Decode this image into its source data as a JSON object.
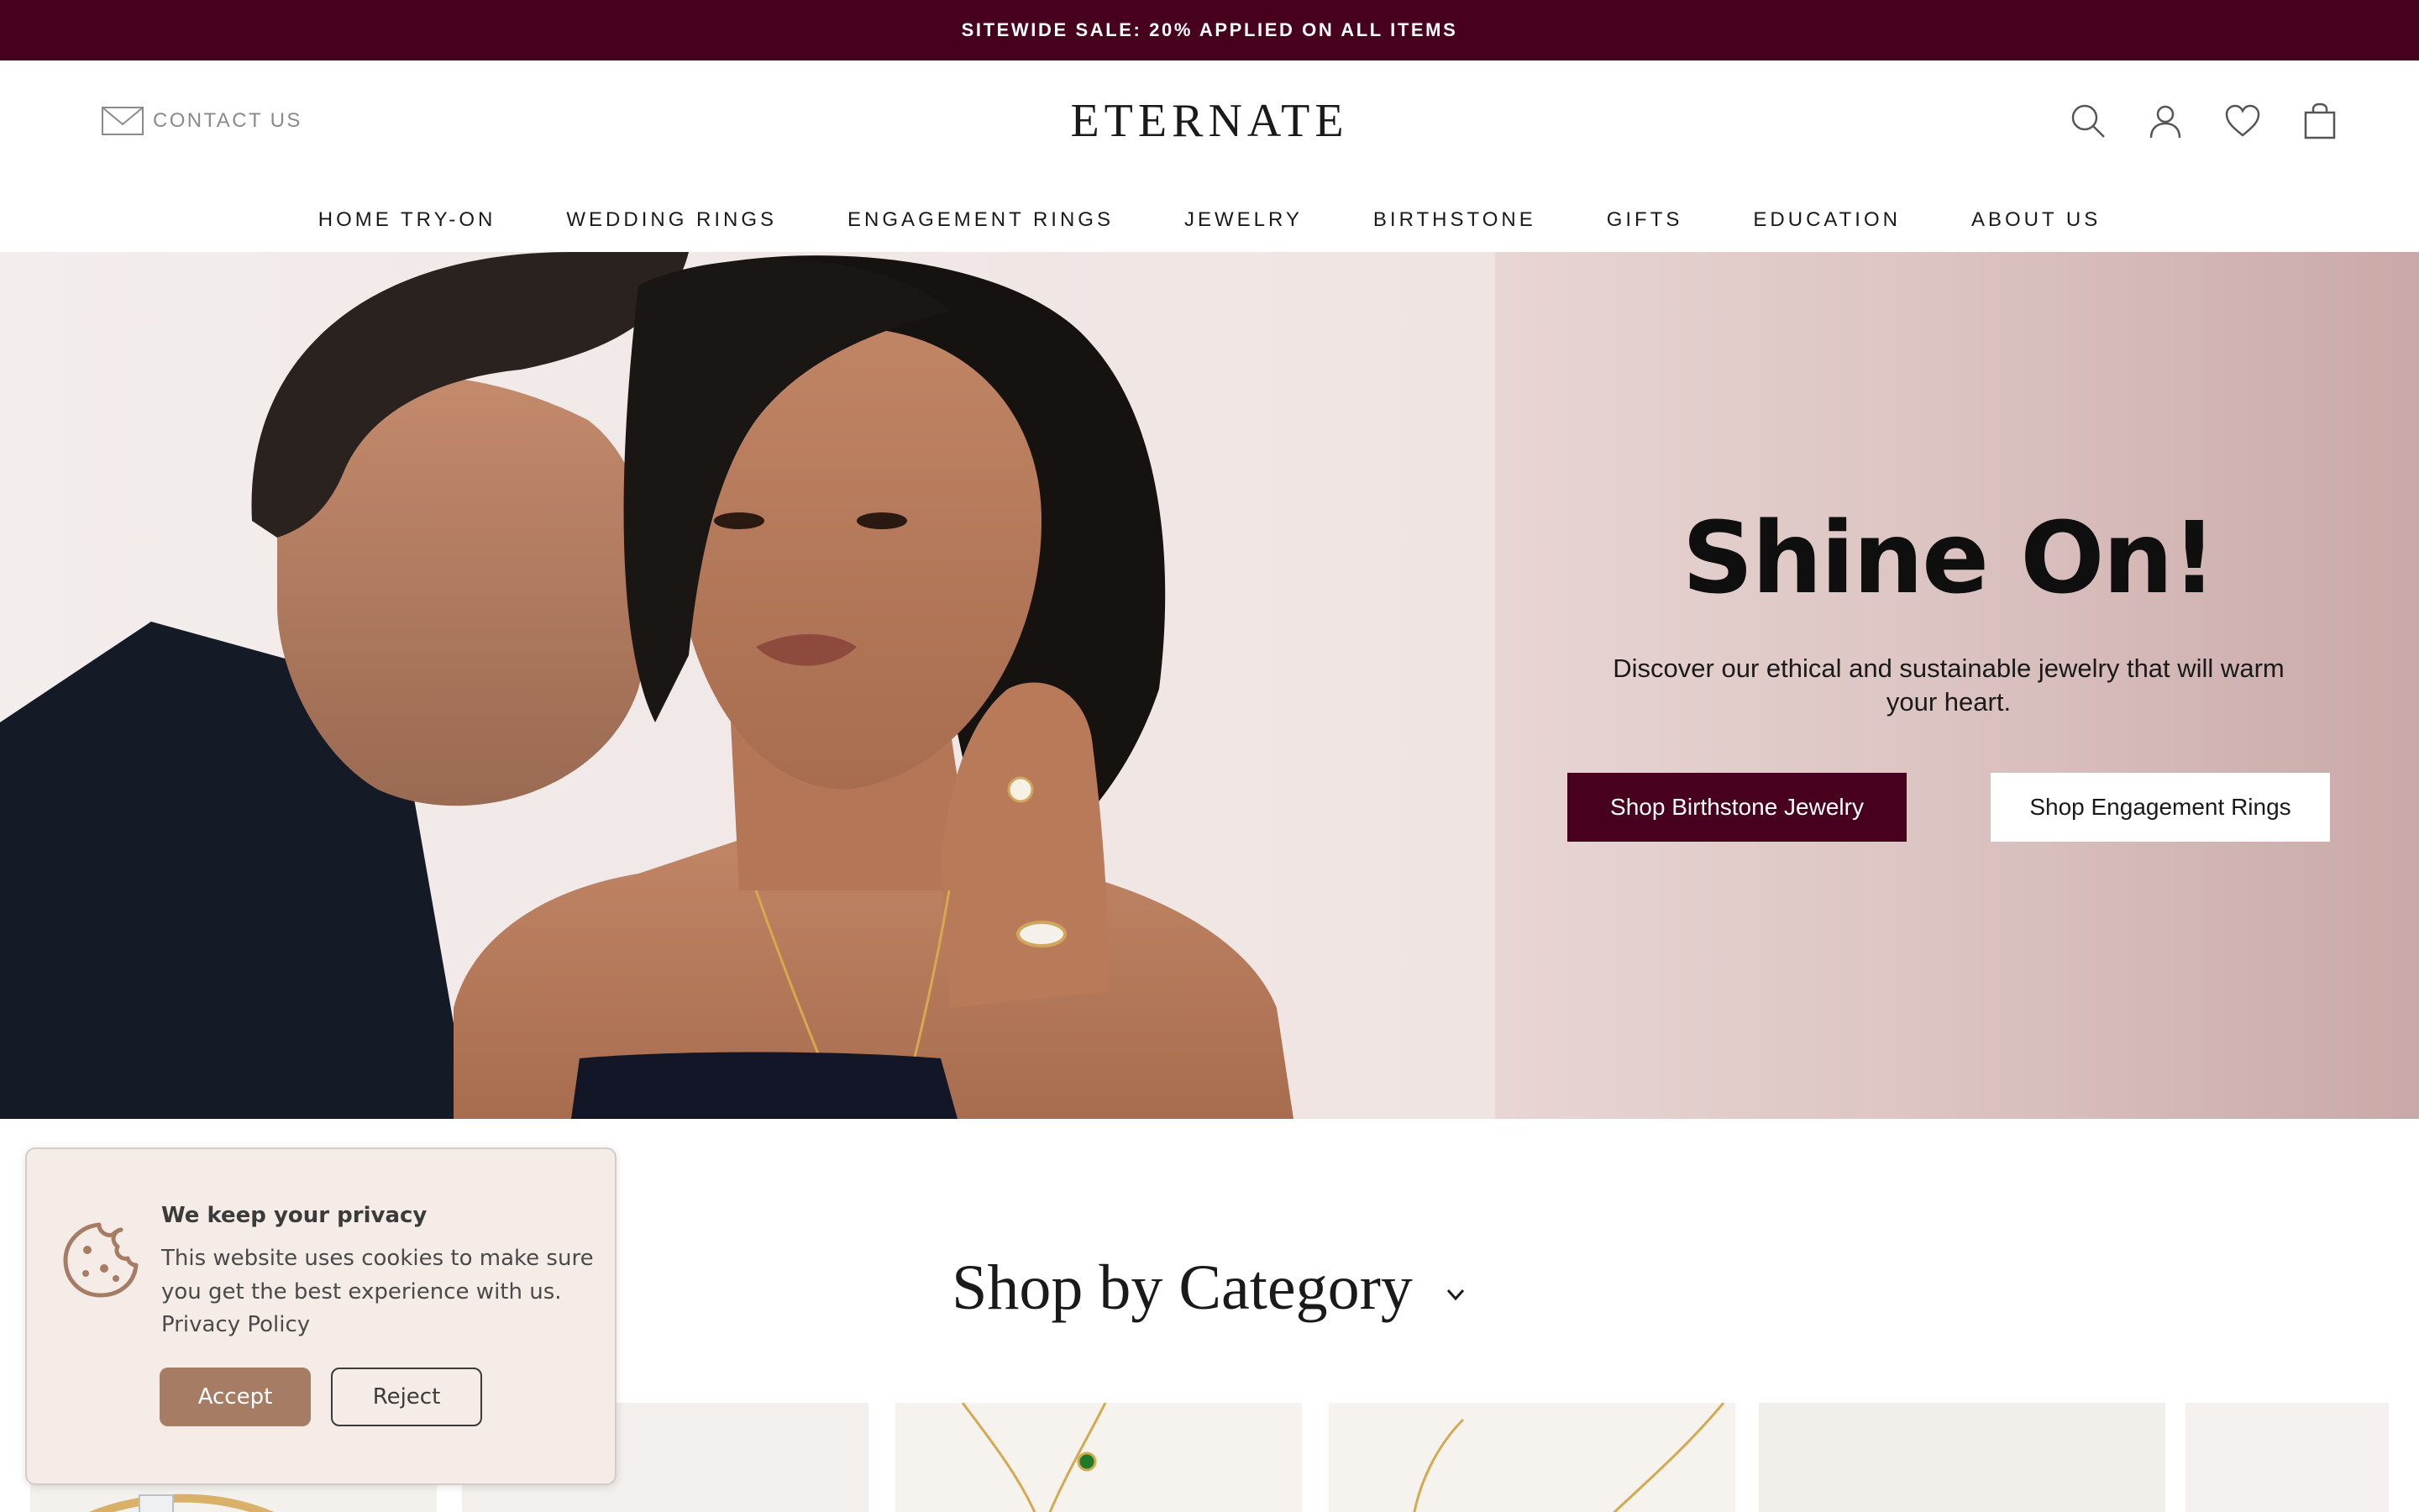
{
  "promo": {
    "text": "SITEWIDE SALE: 20% APPLIED ON ALL ITEMS"
  },
  "header": {
    "contact_label": "CONTACT US",
    "logo": "ETERNATE",
    "icons": [
      "search-icon",
      "account-icon",
      "wishlist-icon",
      "cart-icon"
    ]
  },
  "nav": {
    "items": [
      {
        "label": "HOME TRY-ON"
      },
      {
        "label": "WEDDING RINGS"
      },
      {
        "label": "ENGAGEMENT RINGS"
      },
      {
        "label": "JEWELRY"
      },
      {
        "label": "BIRTHSTONE"
      },
      {
        "label": "GIFTS"
      },
      {
        "label": "EDUCATION"
      },
      {
        "label": "ABOUT US"
      }
    ]
  },
  "hero": {
    "title": "Shine On!",
    "subtitle": "Discover our ethical and sustainable jewelry that will warm your heart.",
    "primary_button": "Shop Birthstone Jewelry",
    "secondary_button": "Shop Engagement Rings"
  },
  "categories": {
    "title": "Shop by Category"
  },
  "cookie": {
    "title": "We keep your privacy",
    "text": "This website uses cookies to make sure you get the best experience with us.",
    "link": "Privacy Policy",
    "accept": "Accept",
    "reject": "Reject"
  },
  "colors": {
    "brand": "#47001e",
    "cookie_accent": "#a67c64",
    "cookie_bg": "#f5ece8"
  }
}
